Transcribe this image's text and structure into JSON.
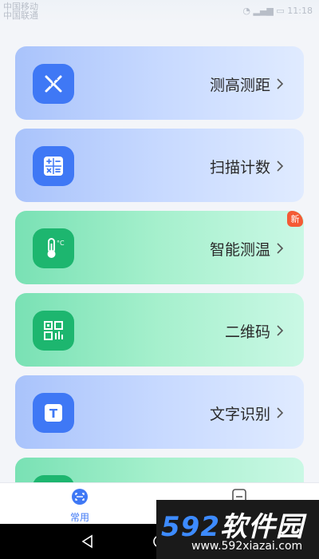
{
  "status_bar": {
    "carrier_line1": "中国移动",
    "carrier_line2": "中国联通",
    "time": "11:18"
  },
  "cards": [
    {
      "label": "测高测距",
      "icon": "ruler-pencil-icon",
      "theme": "blue"
    },
    {
      "label": "扫描计数",
      "icon": "calculator-icon",
      "theme": "blue"
    },
    {
      "label": "智能测温",
      "icon": "thermometer-icon",
      "theme": "green",
      "badge": "新"
    },
    {
      "label": "二维码",
      "icon": "qr-code-icon",
      "theme": "green"
    },
    {
      "label": "文字识别",
      "icon": "text-t-icon",
      "theme": "blue"
    }
  ],
  "bottom_nav": {
    "items": [
      {
        "label": "常用",
        "icon": "scan-face-icon",
        "active": true
      },
      {
        "label": "",
        "icon": "document-icon",
        "active": false
      }
    ]
  },
  "watermark": {
    "logo_num": "592",
    "logo_cn": "软件园",
    "url": "www.592xiazai.com"
  },
  "colors": {
    "accent_blue": "#3f78f5",
    "accent_green": "#1db66f",
    "badge": "#f45a35"
  }
}
